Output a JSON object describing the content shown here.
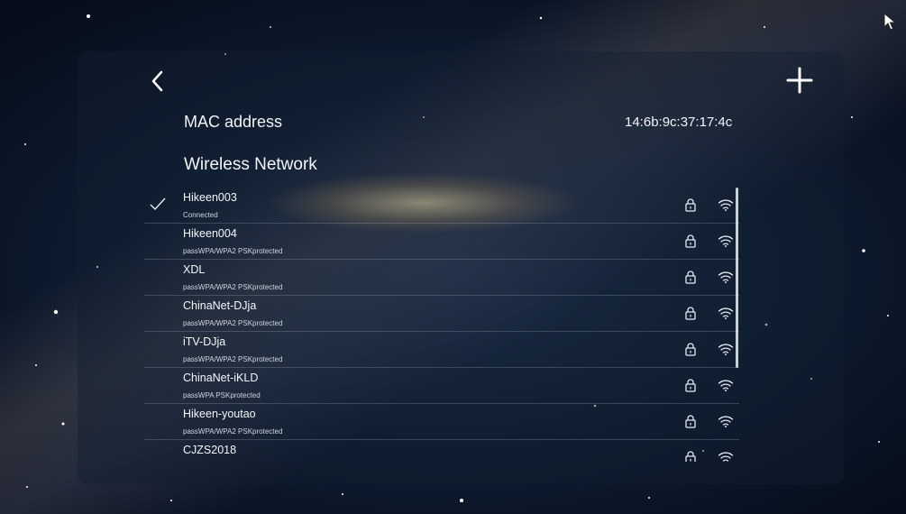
{
  "header": {
    "back_icon": "chevron-left-icon",
    "add_icon": "plus-icon"
  },
  "mac": {
    "label": "MAC address",
    "value": "14:6b:9c:37:17:4c"
  },
  "wireless": {
    "title": "Wireless Network",
    "networks": [
      {
        "name": "Hikeen003",
        "status": "Connected",
        "connected": true
      },
      {
        "name": "Hikeen004",
        "status": "passWPA/WPA2 PSKprotected",
        "connected": false
      },
      {
        "name": "XDL",
        "status": "passWPA/WPA2 PSKprotected",
        "connected": false
      },
      {
        "name": "ChinaNet-DJja",
        "status": "passWPA/WPA2 PSKprotected",
        "connected": false
      },
      {
        "name": "iTV-DJja",
        "status": "passWPA/WPA2 PSKprotected",
        "connected": false
      },
      {
        "name": "ChinaNet-iKLD",
        "status": "passWPA PSKprotected",
        "connected": false
      },
      {
        "name": "Hikeen-youtao",
        "status": "passWPA/WPA2 PSKprotected",
        "connected": false
      },
      {
        "name": "CJZS2018",
        "status": "",
        "connected": false
      }
    ]
  },
  "icons": {
    "lock": "lock-icon",
    "wifi": "wifi-signal-icon",
    "check": "checkmark-icon"
  }
}
